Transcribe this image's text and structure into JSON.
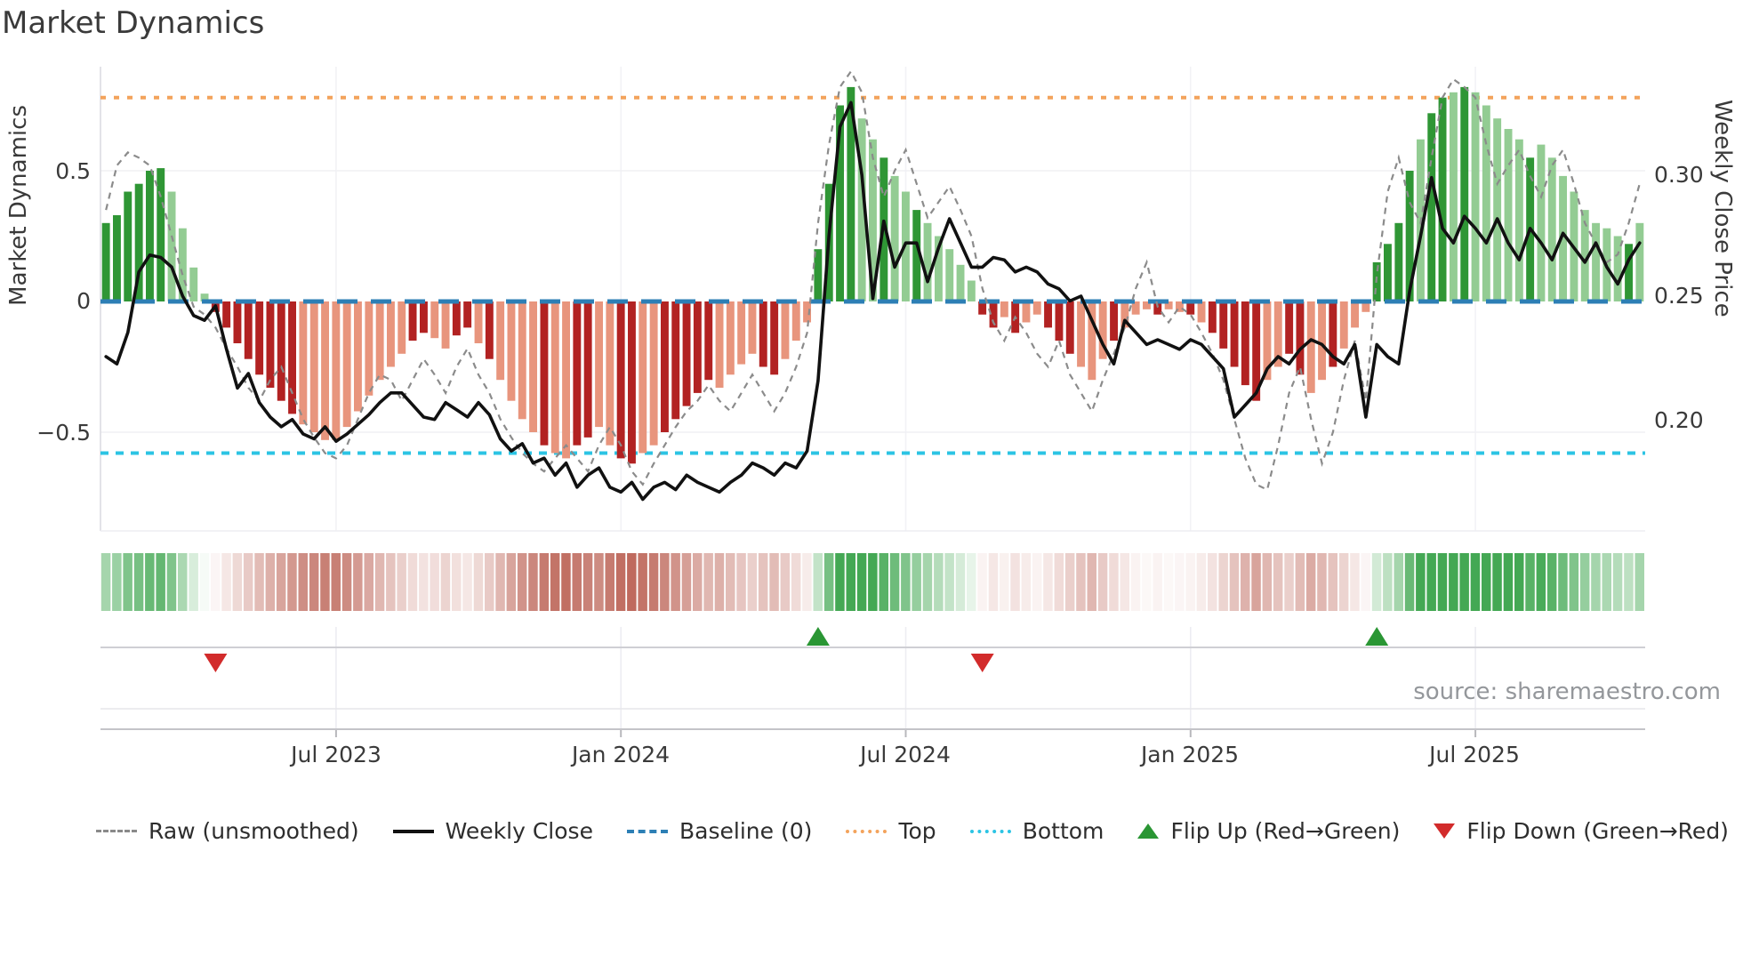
{
  "title": "Market Dynamics",
  "source_text": "source: sharemaestro.com",
  "colors": {
    "bar_green_dark": "#2f9635",
    "bar_green_light": "#93cc93",
    "bar_red_dark": "#b22222",
    "bar_red_light": "#e8957d",
    "weekly_close": "#111111",
    "raw": "#8b8b8b",
    "baseline": "#2d7fb5",
    "top": "#f3a35c",
    "bottom": "#2cc4e4",
    "flip_up": "#2a9634",
    "flip_down": "#d22b2b",
    "heat_green": "#44a854",
    "heat_red": "#bf6a5e",
    "grid": "#f2f2f6",
    "spine": "#dcdce2"
  },
  "chart_data": {
    "type": "combo",
    "title": "Market Dynamics",
    "x_unit": "week",
    "n_points": 141,
    "x_axis": {
      "ticks": [
        {
          "index": 21,
          "label": "Jul 2023"
        },
        {
          "index": 47,
          "label": "Jan 2024"
        },
        {
          "index": 73,
          "label": "Jul 2024"
        },
        {
          "index": 99,
          "label": "Jan 2025"
        },
        {
          "index": 125,
          "label": "Jul 2025"
        }
      ]
    },
    "left_axis": {
      "label": "Market Dynamics",
      "ticks": [
        "0.5",
        "0",
        "−0.5"
      ],
      "tick_values": [
        0.5,
        0,
        -0.5
      ],
      "range": [
        -0.88,
        0.9
      ],
      "grid": true
    },
    "right_axis": {
      "label": "Weekly Close Price",
      "ticks": [
        "0.30",
        "0.25",
        "0.20"
      ],
      "tick_values": [
        0.3,
        0.25,
        0.2
      ],
      "range": [
        0.153,
        0.345
      ]
    },
    "series": [
      {
        "name": "Market Dynamics",
        "type": "bar",
        "axis": "left",
        "values": [
          0.3,
          0.33,
          0.42,
          0.45,
          0.5,
          0.51,
          0.42,
          0.28,
          0.13,
          0.03,
          -0.04,
          -0.1,
          -0.16,
          -0.22,
          -0.28,
          -0.33,
          -0.38,
          -0.43,
          -0.47,
          -0.5,
          -0.53,
          -0.53,
          -0.48,
          -0.42,
          -0.36,
          -0.3,
          -0.25,
          -0.2,
          -0.15,
          -0.12,
          -0.14,
          -0.18,
          -0.13,
          -0.1,
          -0.16,
          -0.22,
          -0.3,
          -0.38,
          -0.45,
          -0.5,
          -0.55,
          -0.58,
          -0.6,
          -0.55,
          -0.52,
          -0.48,
          -0.55,
          -0.6,
          -0.62,
          -0.58,
          -0.55,
          -0.5,
          -0.45,
          -0.4,
          -0.35,
          -0.3,
          -0.33,
          -0.28,
          -0.24,
          -0.2,
          -0.25,
          -0.28,
          -0.22,
          -0.15,
          -0.08,
          0.2,
          0.45,
          0.75,
          0.82,
          0.7,
          0.62,
          0.55,
          0.48,
          0.42,
          0.35,
          0.3,
          0.25,
          0.2,
          0.14,
          0.08,
          -0.05,
          -0.1,
          -0.06,
          -0.12,
          -0.08,
          -0.05,
          -0.1,
          -0.15,
          -0.2,
          -0.25,
          -0.3,
          -0.22,
          -0.15,
          -0.1,
          -0.05,
          -0.03,
          -0.05,
          -0.03,
          -0.04,
          -0.05,
          -0.08,
          -0.12,
          -0.18,
          -0.25,
          -0.32,
          -0.38,
          -0.3,
          -0.25,
          -0.2,
          -0.28,
          -0.35,
          -0.3,
          -0.25,
          -0.18,
          -0.1,
          -0.04,
          0.15,
          0.22,
          0.3,
          0.5,
          0.62,
          0.72,
          0.78,
          0.8,
          0.82,
          0.8,
          0.75,
          0.7,
          0.66,
          0.62,
          0.55,
          0.6,
          0.55,
          0.48,
          0.42,
          0.35,
          0.3,
          0.28,
          0.25,
          0.22,
          0.3
        ],
        "shades": "ddddddllllddddddddllllllllllddllddldlllldllddllddlldddddllllddlllddddlldlldlllllddldlldddllldllldlldldddddllddlldlllddddlddldllllldlllllllld",
        "shade_legend": {
          "d": "dark (strong momentum)",
          "l": "light (fading momentum)"
        }
      },
      {
        "name": "Raw (unsmoothed)",
        "type": "line",
        "style": "dashed",
        "axis": "left",
        "values": [
          0.35,
          0.52,
          0.57,
          0.55,
          0.52,
          0.4,
          0.25,
          0.1,
          -0.02,
          -0.05,
          -0.1,
          -0.18,
          -0.25,
          -0.33,
          -0.38,
          -0.3,
          -0.25,
          -0.35,
          -0.45,
          -0.52,
          -0.58,
          -0.6,
          -0.55,
          -0.45,
          -0.35,
          -0.28,
          -0.3,
          -0.38,
          -0.3,
          -0.22,
          -0.28,
          -0.35,
          -0.25,
          -0.18,
          -0.28,
          -0.35,
          -0.45,
          -0.52,
          -0.58,
          -0.62,
          -0.65,
          -0.6,
          -0.55,
          -0.6,
          -0.65,
          -0.55,
          -0.48,
          -0.55,
          -0.65,
          -0.7,
          -0.62,
          -0.55,
          -0.48,
          -0.42,
          -0.38,
          -0.32,
          -0.38,
          -0.42,
          -0.35,
          -0.28,
          -0.35,
          -0.42,
          -0.35,
          -0.25,
          -0.12,
          0.3,
          0.6,
          0.82,
          0.88,
          0.8,
          0.55,
          0.4,
          0.5,
          0.58,
          0.45,
          0.32,
          0.38,
          0.44,
          0.35,
          0.25,
          0.05,
          -0.08,
          -0.15,
          -0.06,
          -0.12,
          -0.2,
          -0.25,
          -0.15,
          -0.28,
          -0.35,
          -0.42,
          -0.3,
          -0.2,
          -0.1,
          0.05,
          0.15,
          -0.02,
          -0.08,
          -0.02,
          -0.05,
          -0.12,
          -0.2,
          -0.3,
          -0.45,
          -0.6,
          -0.7,
          -0.72,
          -0.55,
          -0.35,
          -0.25,
          -0.45,
          -0.62,
          -0.5,
          -0.3,
          -0.15,
          -0.38,
          0.1,
          0.42,
          0.55,
          0.38,
          0.3,
          0.55,
          0.78,
          0.85,
          0.82,
          0.78,
          0.6,
          0.45,
          0.52,
          0.58,
          0.48,
          0.4,
          0.52,
          0.58,
          0.45,
          0.3,
          0.22,
          0.15,
          0.18,
          0.3,
          0.45
        ]
      },
      {
        "name": "Weekly Close",
        "type": "line",
        "style": "solid",
        "axis": "right",
        "values": [
          0.225,
          0.222,
          0.235,
          0.26,
          0.267,
          0.266,
          0.262,
          0.25,
          0.242,
          0.24,
          0.246,
          0.228,
          0.212,
          0.218,
          0.206,
          0.2,
          0.196,
          0.199,
          0.193,
          0.191,
          0.196,
          0.19,
          0.193,
          0.197,
          0.201,
          0.206,
          0.21,
          0.21,
          0.205,
          0.2,
          0.199,
          0.206,
          0.203,
          0.2,
          0.206,
          0.201,
          0.191,
          0.186,
          0.189,
          0.181,
          0.183,
          0.176,
          0.181,
          0.171,
          0.176,
          0.179,
          0.171,
          0.169,
          0.173,
          0.166,
          0.171,
          0.173,
          0.17,
          0.176,
          0.173,
          0.171,
          0.169,
          0.173,
          0.176,
          0.181,
          0.179,
          0.176,
          0.181,
          0.179,
          0.186,
          0.215,
          0.275,
          0.32,
          0.33,
          0.3,
          0.249,
          0.281,
          0.262,
          0.272,
          0.272,
          0.256,
          0.27,
          0.282,
          0.272,
          0.262,
          0.262,
          0.266,
          0.265,
          0.26,
          0.262,
          0.26,
          0.255,
          0.253,
          0.248,
          0.25,
          0.24,
          0.23,
          0.222,
          0.24,
          0.235,
          0.23,
          0.232,
          0.23,
          0.228,
          0.232,
          0.23,
          0.225,
          0.22,
          0.2,
          0.205,
          0.21,
          0.22,
          0.225,
          0.222,
          0.228,
          0.232,
          0.23,
          0.225,
          0.222,
          0.23,
          0.2,
          0.23,
          0.225,
          0.222,
          0.252,
          0.275,
          0.299,
          0.278,
          0.272,
          0.283,
          0.278,
          0.272,
          0.282,
          0.272,
          0.265,
          0.278,
          0.272,
          0.265,
          0.276,
          0.27,
          0.264,
          0.272,
          0.262,
          0.255,
          0.265,
          0.272
        ]
      }
    ],
    "reference_lines": [
      {
        "name": "Baseline (0)",
        "axis": "left",
        "value": 0,
        "style": "dashed",
        "color_key": "baseline"
      },
      {
        "name": "Top",
        "axis": "left",
        "value": 0.78,
        "style": "dotted",
        "color_key": "top"
      },
      {
        "name": "Bottom",
        "axis": "left",
        "value": -0.58,
        "style": "dotted",
        "color_key": "bottom"
      }
    ],
    "flip_markers": [
      {
        "index": 10,
        "direction": "down"
      },
      {
        "index": 65,
        "direction": "up"
      },
      {
        "index": 80,
        "direction": "down"
      },
      {
        "index": 116,
        "direction": "up"
      }
    ],
    "heatmap": {
      "derived_from": "Market Dynamics bar values",
      "position": "strip below main chart",
      "intensity_cap": 0.62
    },
    "legend_position": "bottom"
  },
  "legend": {
    "items": [
      {
        "label": "Raw (unsmoothed)",
        "swatch": "dashed-gray-line"
      },
      {
        "label": "Weekly Close",
        "swatch": "solid-black-line"
      },
      {
        "label": "Baseline (0)",
        "swatch": "dashed-blue-line"
      },
      {
        "label": "Top",
        "swatch": "dotted-orange-line"
      },
      {
        "label": "Bottom",
        "swatch": "dotted-cyan-line"
      },
      {
        "label": "Flip Up (Red→Green)",
        "swatch": "green-up-triangle"
      },
      {
        "label": "Flip Down (Green→Red)",
        "swatch": "red-down-triangle"
      }
    ]
  }
}
